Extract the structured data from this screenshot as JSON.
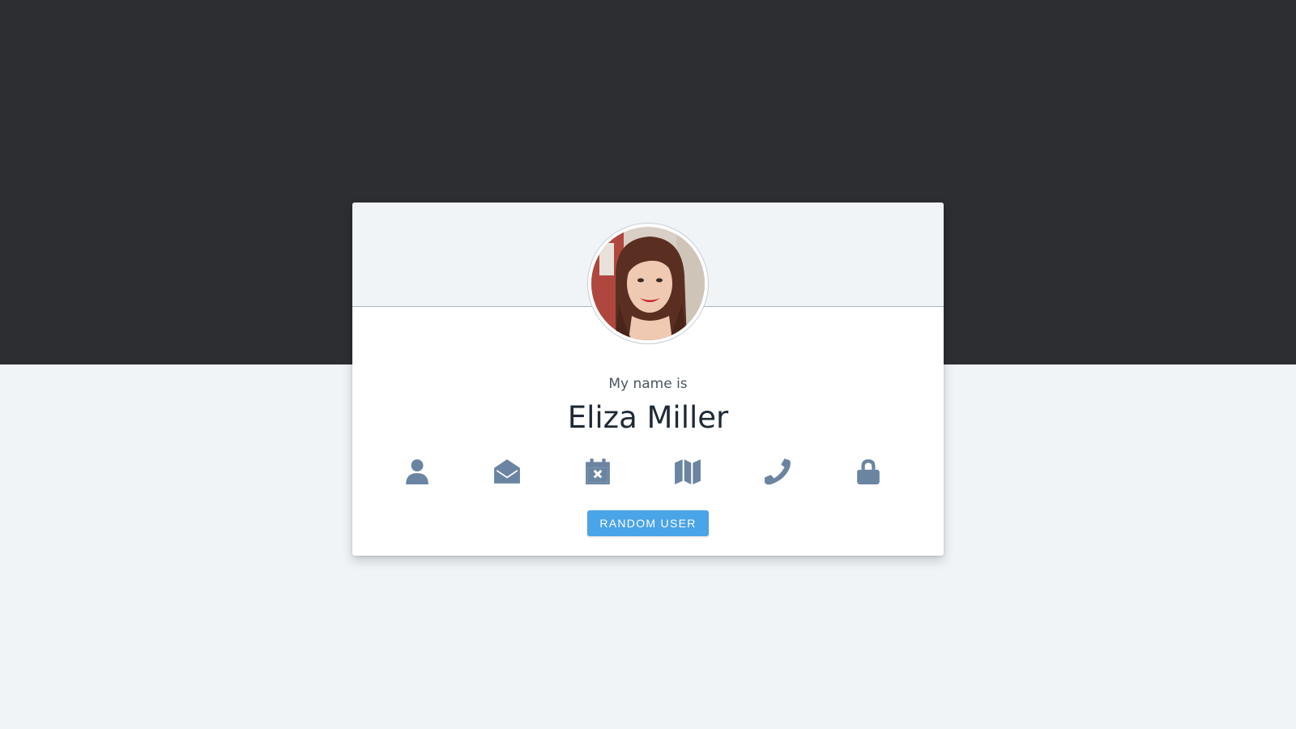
{
  "profile": {
    "label": "My name is",
    "value": "Eliza Miller"
  },
  "icons": [
    {
      "name": "user-icon"
    },
    {
      "name": "envelope-open-icon"
    },
    {
      "name": "calendar-x-icon"
    },
    {
      "name": "map-icon"
    },
    {
      "name": "phone-icon"
    },
    {
      "name": "lock-icon"
    }
  ],
  "actions": {
    "random_label": "RANDOM USER"
  },
  "colors": {
    "top_band": "#2c2e32",
    "page_bg": "#f0f4f7",
    "icon": "#6b84a1",
    "button": "#4aa4e8",
    "name_text": "#1e2a36"
  }
}
